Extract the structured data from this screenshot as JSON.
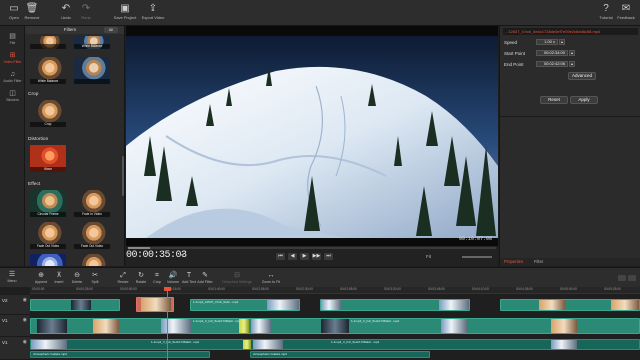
{
  "toolbar": {
    "items": [
      {
        "label": "Open",
        "icon": "folder-icon"
      },
      {
        "label": "Remove",
        "icon": "trash-icon"
      },
      {
        "label": "Undo",
        "icon": "undo-icon"
      },
      {
        "label": "Redo",
        "icon": "redo-icon"
      },
      {
        "label": "Save Project",
        "icon": "save-icon"
      },
      {
        "label": "Export Video",
        "icon": "export-icon"
      },
      {
        "label": "Tutorial",
        "icon": "help-icon"
      },
      {
        "label": "Feedback",
        "icon": "mail-icon"
      }
    ]
  },
  "sidetabs": [
    {
      "label": "File",
      "icon": "film-icon"
    },
    {
      "label": "Video Filter",
      "icon": "filter-icon",
      "active": true
    },
    {
      "label": "Audio Filter",
      "icon": "music-icon"
    },
    {
      "label": "Stickers",
      "icon": "sticker-icon"
    }
  ],
  "library": {
    "title": "Filters",
    "all_label": "All",
    "categories": [
      "Crop",
      "Distortion",
      "Effect"
    ],
    "items": {
      "top": [
        "",
        "White Balance"
      ],
      "top2": [
        "White Balance",
        ""
      ],
      "crop": [
        "Crop"
      ],
      "distortion": [
        "Wave"
      ],
      "effect": [
        "Circular Frame",
        "Fade In Video",
        "Fade Out Video",
        "Fade Out Video",
        "",
        ""
      ]
    }
  },
  "preview": {
    "timecode": "00:00:35:03",
    "timecode_arrow": "▾",
    "duration": "00:10:07:08",
    "playback_position": 0.06,
    "fit_label": "Fit",
    "controls": [
      "⏮",
      "◀",
      "▶",
      "▶▶",
      "⏭"
    ]
  },
  "props": {
    "clip_name": "...12637_V.hdr_5e4c1728de0ef7e09e2c8dd6c58.mp4",
    "speed_label": "Speed",
    "speed_value": "1.00 x",
    "start_label": "Start Point",
    "start_value": "00:02:34:00",
    "end_label": "End Point",
    "end_value": "00:02:42:06",
    "advanced_label": "Advanced",
    "reset_label": "Reset",
    "apply_label": "Apply",
    "tab_properties": "Properties",
    "tab_filter": "Filter"
  },
  "timeline_tools": [
    {
      "label": "Append",
      "icon": "append-icon"
    },
    {
      "label": "Insert",
      "icon": "insert-icon"
    },
    {
      "label": "Delete",
      "icon": "delete-icon"
    },
    {
      "label": "Split",
      "icon": "split-icon"
    },
    {
      "label": "Resize",
      "icon": "resize-icon"
    },
    {
      "label": "Rotate",
      "icon": "rotate-icon"
    },
    {
      "label": "Crop",
      "icon": "crop-icon"
    },
    {
      "label": "Volume",
      "icon": "volume-icon"
    },
    {
      "label": "Add Text",
      "icon": "text-icon"
    },
    {
      "label": "Add Filter",
      "icon": "add-filter-icon"
    },
    {
      "label": "Detached Settings",
      "icon": "detach-icon",
      "dim": true
    },
    {
      "label": "Zoom to Fit",
      "icon": "zoom-fit-icon"
    }
  ],
  "menu_label": "Menu",
  "timeline": {
    "ruler": [
      "00:00:00",
      "00:00:25:00",
      "00:00:50:00",
      "00:01:15:00",
      "00:01:40:00",
      "00:02:05:00",
      "00:02:30:00",
      "00:02:55:00",
      "00:03:20:00",
      "00:03:45:00",
      "00:04:10:00",
      "00:04:35:00",
      "00:05:00:00",
      "00:05:25:00"
    ],
    "tracks": [
      {
        "name": "V2",
        "icon": "eye-icon"
      },
      {
        "name": "V1",
        "icon": "eye-icon"
      },
      {
        "name": "V1",
        "icon": "eye-icon"
      }
    ],
    "clip_labels": {
      "a": "1-1mp4_12637_V.hdr_5e4c...mp4",
      "b": "1-1mp4_V_hdr_5e4c1728de0...mp4",
      "c": "1-1mp4_V_hdr_5e4c1728de0...mp4",
      "d": "1-1mp4_V_hdr_5e4c1728de0...mp4",
      "e": "1-1mp4_V_hdr_5e4c1728de0...mp4",
      "f": "Atmospheric Guitars.mp3",
      "g": "Atmospheric Guitars.mp3"
    }
  }
}
